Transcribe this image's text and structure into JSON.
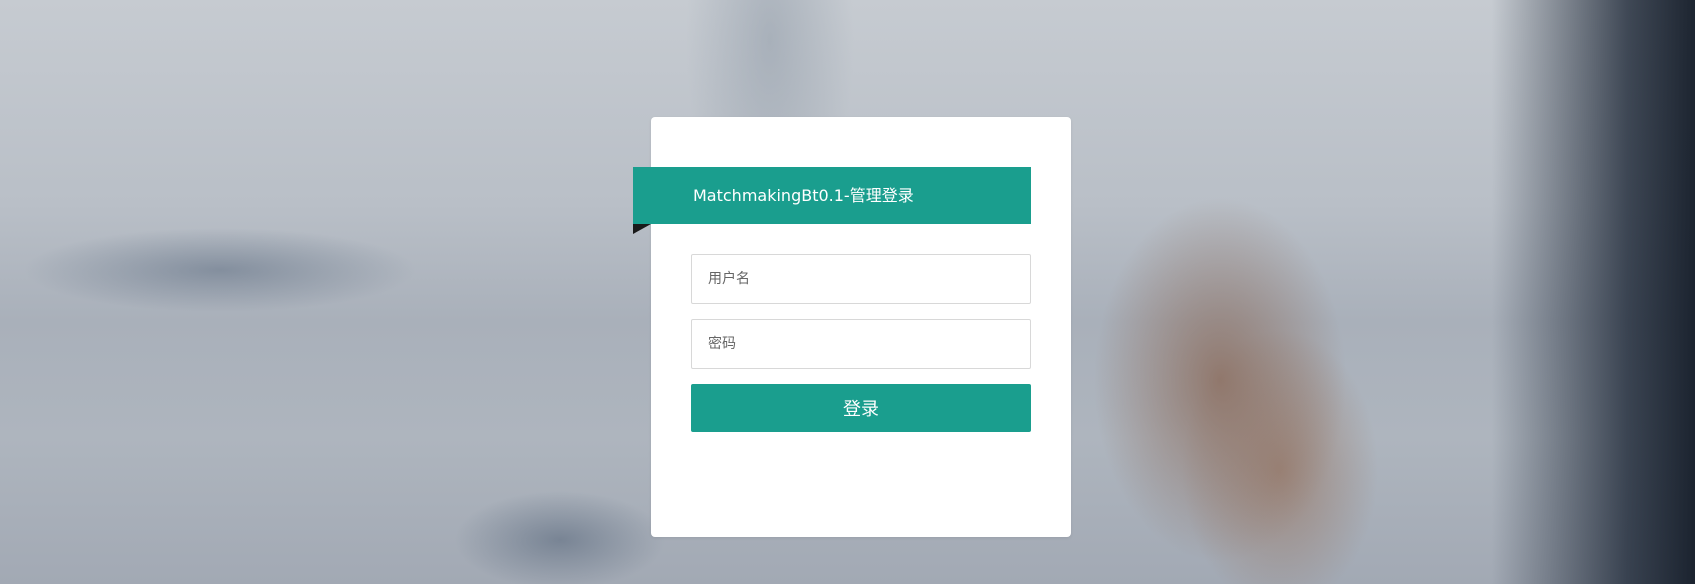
{
  "login": {
    "title": "MatchmakingBt0.1-管理登录",
    "username_placeholder": "用户名",
    "username_value": "",
    "password_placeholder": "密码",
    "password_value": "",
    "submit_label": "登录"
  },
  "colors": {
    "accent": "#1a9e8e",
    "card_background": "#ffffff"
  }
}
